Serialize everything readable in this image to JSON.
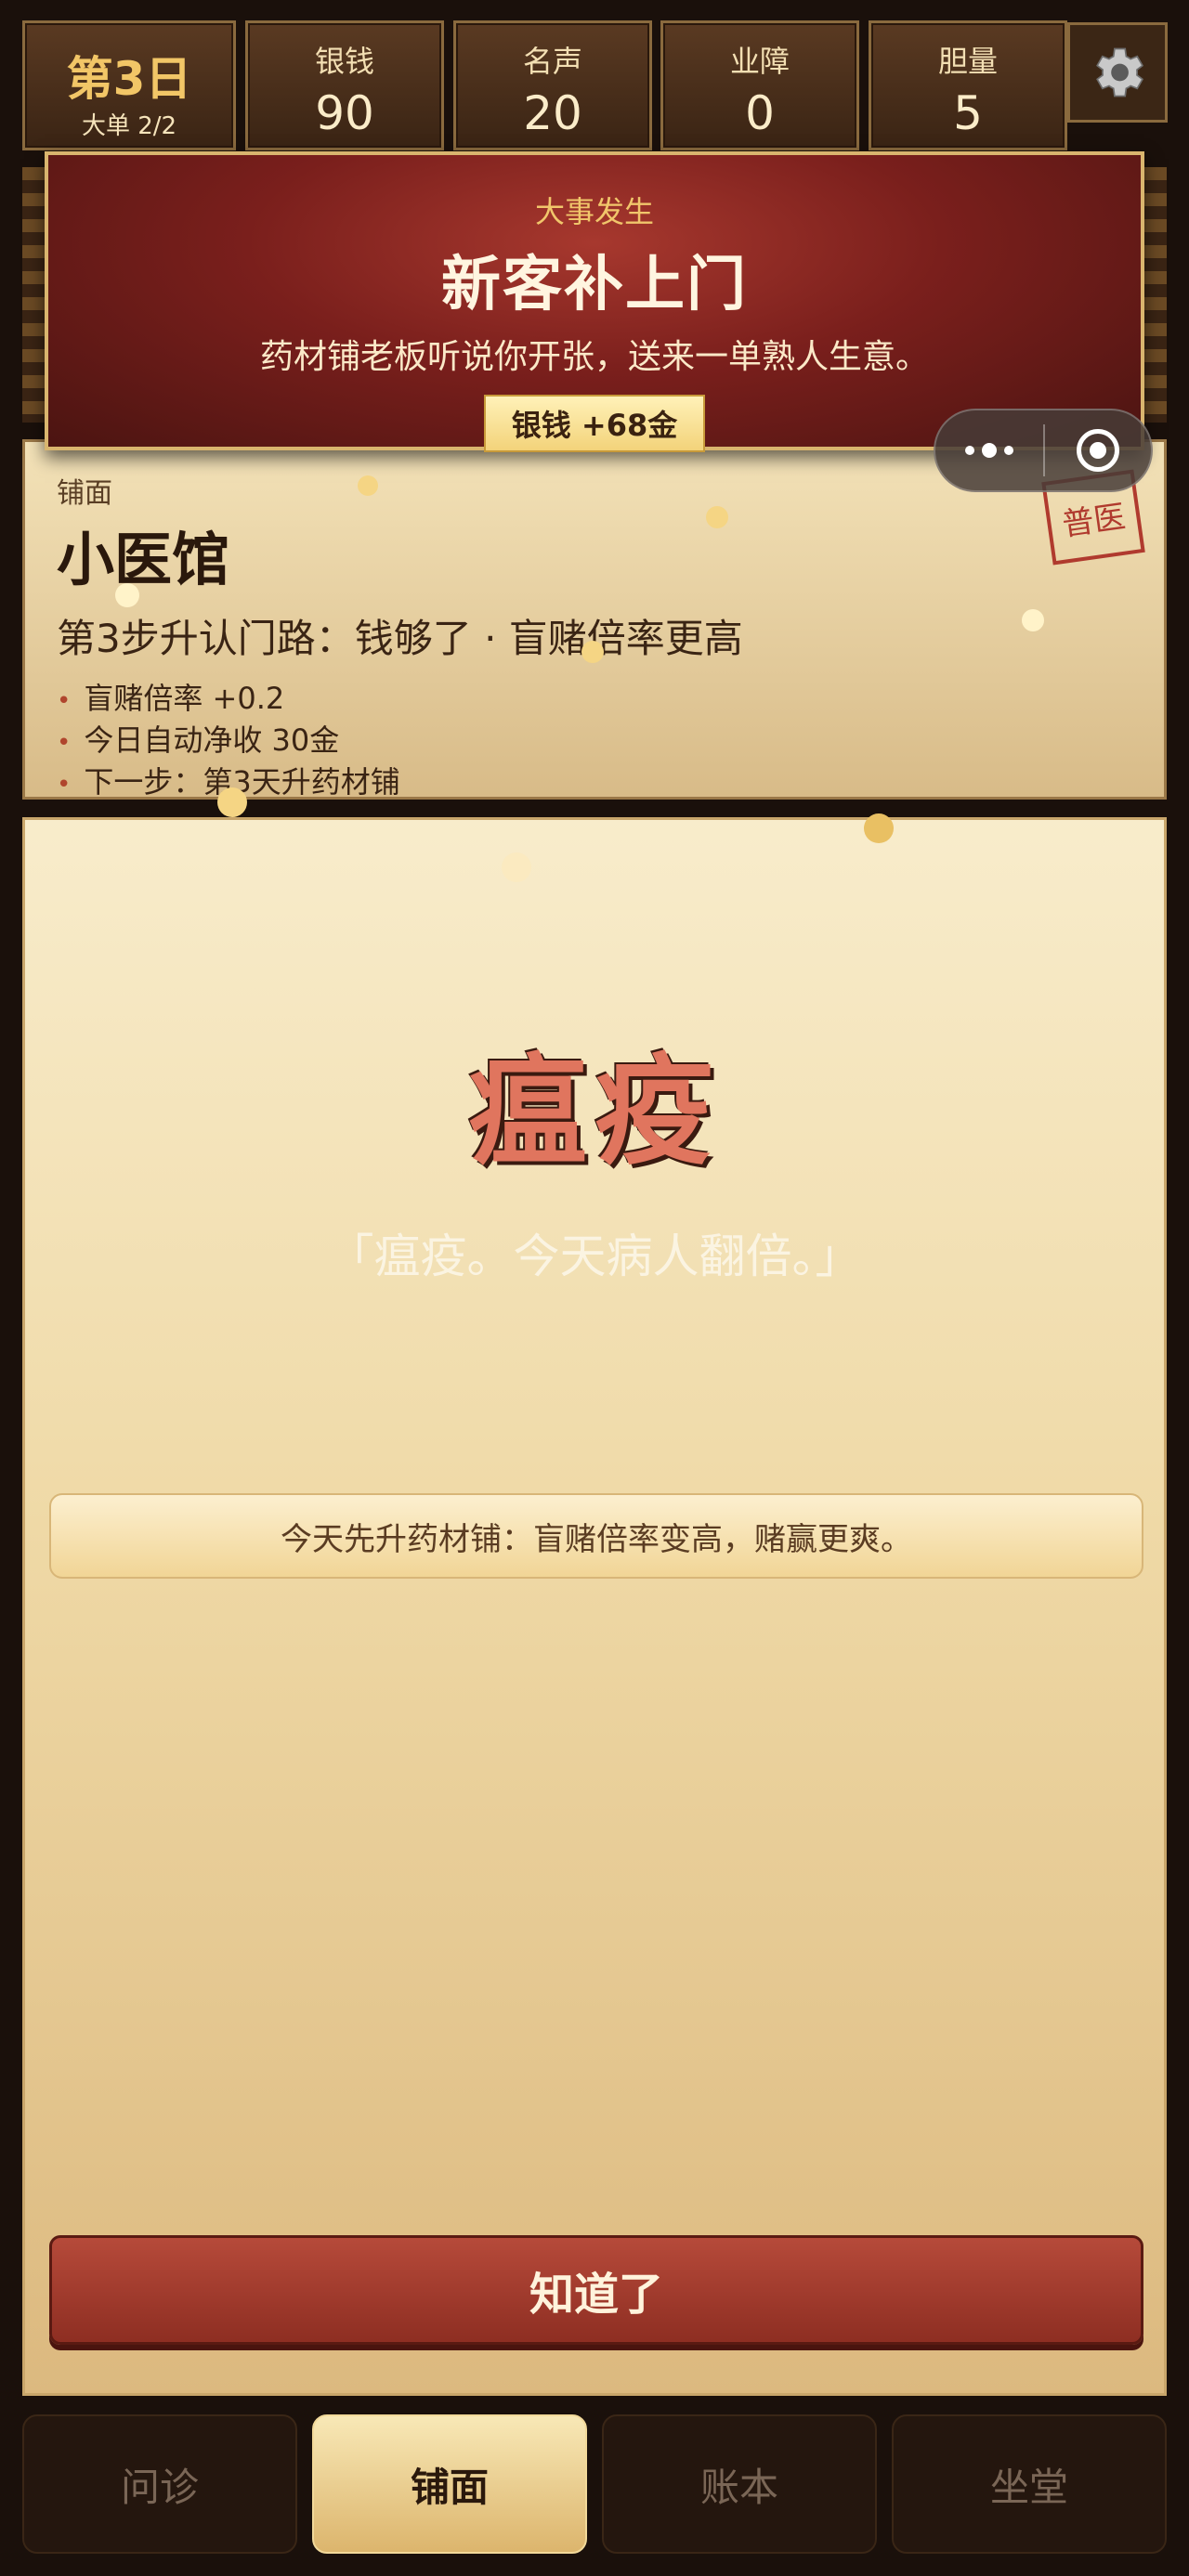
{
  "stats": {
    "day_label": "第3日",
    "day_sub": "大单 2/2",
    "silver_label": "银钱",
    "silver_value": "90",
    "fame_label": "名声",
    "fame_value": "20",
    "karma_label": "业障",
    "karma_value": "0",
    "courage_label": "胆量",
    "courage_value": "5"
  },
  "event": {
    "kicker": "大事发生",
    "title": "新客补上门",
    "description": "药材铺老板听说你开张，送来一单熟人生意。",
    "reward": "银钱 +68金"
  },
  "shop": {
    "caption": "铺面",
    "name": "小医馆",
    "step": "第3步升认门路：钱够了 · 盲赌倍率更高",
    "bullets": [
      "盲赌倍率 +0.2",
      "今日自动净收 30金",
      "下一步：第3天升药材铺"
    ],
    "stamp": "普医"
  },
  "modal": {
    "headline": "瘟疫",
    "quote": "「瘟疫。今天病人翻倍。」",
    "tip": "今天先升药材铺：盲赌倍率变高，赌赢更爽。",
    "confirm": "知道了"
  },
  "tabs": [
    {
      "label": "问诊",
      "active": false
    },
    {
      "label": "铺面",
      "active": true
    },
    {
      "label": "账本",
      "active": false
    },
    {
      "label": "坐堂",
      "active": false
    }
  ],
  "icons": {
    "settings": "gear-icon",
    "capsule_more": "more-dots-icon",
    "capsule_close": "target-close-icon"
  },
  "colors": {
    "accent_red": "#8e2e22",
    "gold": "#f2c667",
    "headline": "#e0755e"
  }
}
